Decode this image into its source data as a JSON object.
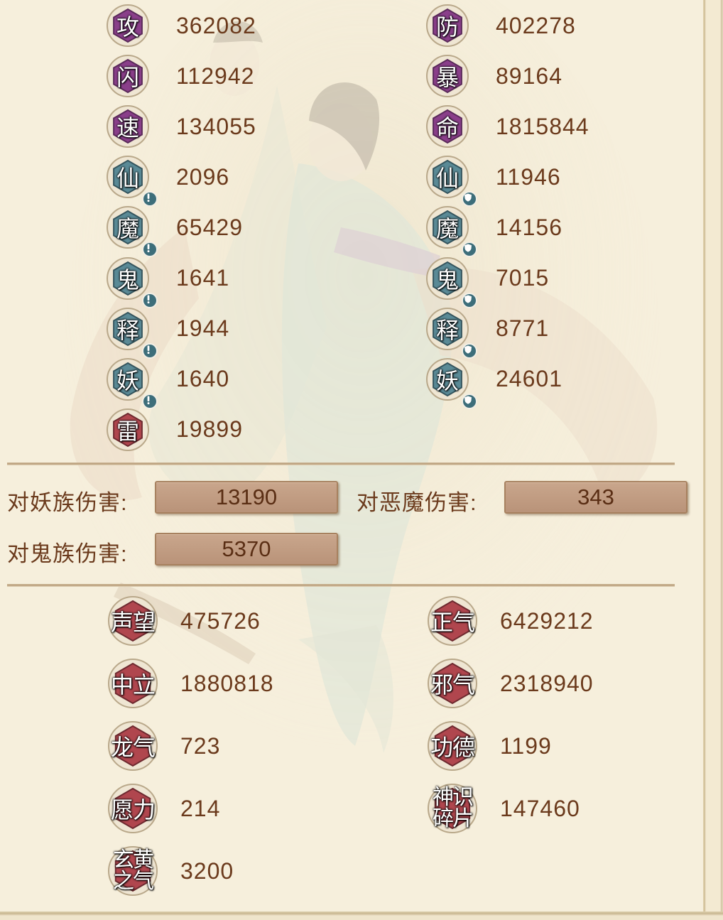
{
  "stats_left": [
    {
      "char": "攻",
      "value": "362082",
      "color": "purple",
      "badge": ""
    },
    {
      "char": "闪",
      "value": "112942",
      "color": "purple",
      "badge": ""
    },
    {
      "char": "速",
      "value": "134055",
      "color": "purple",
      "badge": ""
    },
    {
      "char": "仙",
      "value": "2096",
      "color": "teal",
      "badge": "alert"
    },
    {
      "char": "魔",
      "value": "65429",
      "color": "teal",
      "badge": "alert"
    },
    {
      "char": "鬼",
      "value": "1641",
      "color": "teal",
      "badge": "alert"
    },
    {
      "char": "释",
      "value": "1944",
      "color": "teal",
      "badge": "alert"
    },
    {
      "char": "妖",
      "value": "1640",
      "color": "teal",
      "badge": "alert"
    },
    {
      "char": "雷",
      "value": "19899",
      "color": "red",
      "badge": ""
    }
  ],
  "stats_right": [
    {
      "char": "防",
      "value": "402278",
      "color": "purple",
      "badge": ""
    },
    {
      "char": "暴",
      "value": "89164",
      "color": "purple",
      "badge": ""
    },
    {
      "char": "命",
      "value": "1815844",
      "color": "purple",
      "badge": ""
    },
    {
      "char": "仙",
      "value": "11946",
      "color": "teal",
      "badge": "shield"
    },
    {
      "char": "魔",
      "value": "14156",
      "color": "teal",
      "badge": "shield"
    },
    {
      "char": "鬼",
      "value": "7015",
      "color": "teal",
      "badge": "shield"
    },
    {
      "char": "释",
      "value": "8771",
      "color": "teal",
      "badge": "shield"
    },
    {
      "char": "妖",
      "value": "24601",
      "color": "teal",
      "badge": "shield"
    }
  ],
  "damage": {
    "vs_yao_label": "对妖族伤害:",
    "vs_yao_value": "13190",
    "vs_emo_label": "对恶魔伤害:",
    "vs_emo_value": "343",
    "vs_gui_label": "对鬼族伤害:",
    "vs_gui_value": "5370"
  },
  "reputation_left": [
    {
      "label": "声望",
      "value": "475726"
    },
    {
      "label": "中立",
      "value": "1880818"
    },
    {
      "label": "龙气",
      "value": "723"
    },
    {
      "label": "愿力",
      "value": "214"
    },
    {
      "label": "玄黄之气",
      "value": "3200"
    }
  ],
  "reputation_right": [
    {
      "label": "正气",
      "value": "6429212"
    },
    {
      "label": "邪气",
      "value": "2318940"
    },
    {
      "label": "功德",
      "value": "1199"
    },
    {
      "label": "神识碎片",
      "value": "147460"
    }
  ],
  "colors": {
    "purple": "#8a3f8a",
    "teal": "#5a8a96",
    "red": "#b0464e",
    "value_text": "#6b3a1c",
    "background": "#f6efdc"
  },
  "icons": {
    "alert_badge": "exclamation-icon",
    "shield_badge": "shield-icon"
  }
}
